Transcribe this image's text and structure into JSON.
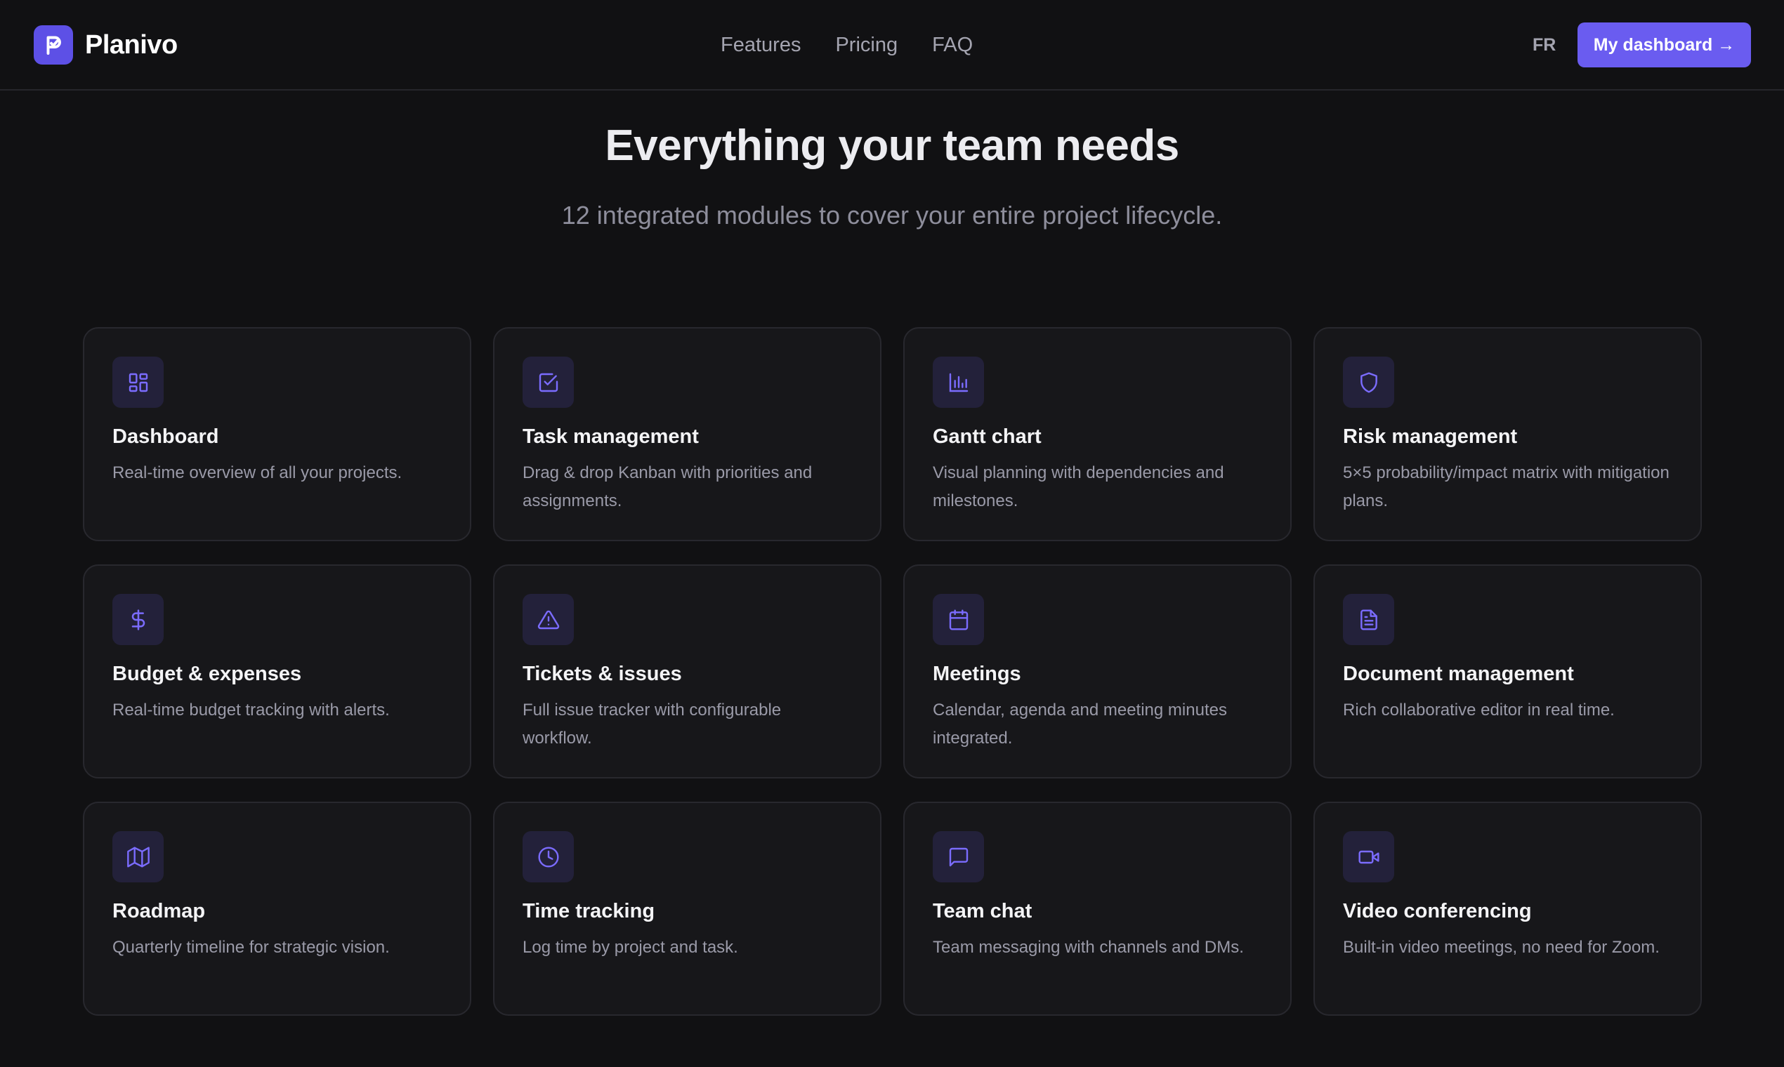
{
  "header": {
    "brand": "Planivo",
    "nav": [
      "Features",
      "Pricing",
      "FAQ"
    ],
    "language": "FR",
    "cta_label": "My dashboard →"
  },
  "hero": {
    "title": "Everything your team needs",
    "subtitle": "12 integrated modules to cover your entire project lifecycle."
  },
  "colors": {
    "background": "#111113",
    "card": "#17171a",
    "accent": "#6a5cf0",
    "icon": "#7b6cff"
  },
  "features": [
    {
      "icon": "dashboard-icon",
      "title": "Dashboard",
      "desc": "Real-time overview of all your projects."
    },
    {
      "icon": "checkbox-icon",
      "title": "Task management",
      "desc": "Drag & drop Kanban with priorities and assignments."
    },
    {
      "icon": "bar-chart-icon",
      "title": "Gantt chart",
      "desc": "Visual planning with dependencies and milestones."
    },
    {
      "icon": "shield-icon",
      "title": "Risk management",
      "desc": "5×5 probability/impact matrix with mitigation plans."
    },
    {
      "icon": "dollar-icon",
      "title": "Budget & expenses",
      "desc": "Real-time budget tracking with alerts."
    },
    {
      "icon": "warning-icon",
      "title": "Tickets & issues",
      "desc": "Full issue tracker with configurable workflow."
    },
    {
      "icon": "calendar-icon",
      "title": "Meetings",
      "desc": "Calendar, agenda and meeting minutes integrated."
    },
    {
      "icon": "document-icon",
      "title": "Document management",
      "desc": "Rich collaborative editor in real time."
    },
    {
      "icon": "map-icon",
      "title": "Roadmap",
      "desc": "Quarterly timeline for strategic vision."
    },
    {
      "icon": "clock-icon",
      "title": "Time tracking",
      "desc": "Log time by project and task."
    },
    {
      "icon": "chat-icon",
      "title": "Team chat",
      "desc": "Team messaging with channels and DMs."
    },
    {
      "icon": "video-icon",
      "title": "Video conferencing",
      "desc": "Built-in video meetings, no need for Zoom."
    }
  ]
}
